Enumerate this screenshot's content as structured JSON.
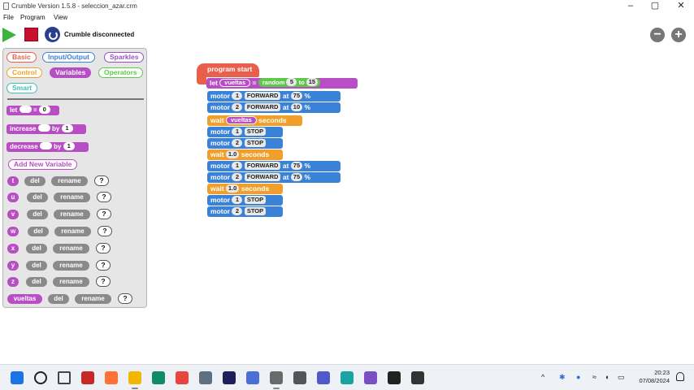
{
  "window": {
    "title": "Crumble Version 1.5.8 - seleccion_azar.crm",
    "controls": {
      "minimize": "–",
      "maximize": "▢",
      "close": "✕"
    }
  },
  "menu": [
    "File",
    "Program",
    "View"
  ],
  "toolbar": {
    "status": "Crumble disconnected",
    "zoom_out": "−",
    "zoom_in": "+",
    "colors": {
      "play": "#3cb43c",
      "stop": "#c8102e",
      "refresh": "#2a3f8f"
    }
  },
  "palette": {
    "categories": {
      "basic": "Basic",
      "io": "Input/Output",
      "sparkles": "Sparkles",
      "control": "Control",
      "variables": "Variables",
      "operators": "Operators",
      "smart": "Smart"
    },
    "let_block": {
      "keyword": "let",
      "eq": "=",
      "value": "0"
    },
    "increase_block": {
      "keyword": "increase",
      "by": "by",
      "value": "1"
    },
    "decrease_block": {
      "keyword": "decrease",
      "by": "by",
      "value": "1"
    },
    "add_variable": "Add New Variable",
    "del_label": "del",
    "rename_label": "rename",
    "help_label": "?",
    "variables": [
      "t",
      "u",
      "v",
      "w",
      "x",
      "y",
      "z",
      "vueltas"
    ]
  },
  "program": {
    "start": "program start",
    "let": {
      "keyword": "let",
      "variable": "vueltas",
      "eq": "=",
      "random": "random",
      "from": "5",
      "to_word": "to",
      "to": "15"
    },
    "steps": [
      {
        "kind": "motor-fwd",
        "motor": "motor",
        "num": "1",
        "dir": "FORWARD",
        "at": "at",
        "speed": "75",
        "pct": "%"
      },
      {
        "kind": "motor-fwd",
        "motor": "motor",
        "num": "2",
        "dir": "FORWARD",
        "at": "at",
        "speed": "10",
        "pct": "%"
      },
      {
        "kind": "wait-var",
        "wait": "wait",
        "var": "vueltas",
        "unit": "seconds"
      },
      {
        "kind": "motor-stop",
        "motor": "motor",
        "num": "1",
        "dir": "STOP"
      },
      {
        "kind": "motor-stop",
        "motor": "motor",
        "num": "2",
        "dir": "STOP"
      },
      {
        "kind": "wait-num",
        "wait": "wait",
        "value": "1.0",
        "unit": "seconds"
      },
      {
        "kind": "motor-fwd",
        "motor": "motor",
        "num": "1",
        "dir": "FORWARD",
        "at": "at",
        "speed": "75",
        "pct": "%"
      },
      {
        "kind": "motor-fwd",
        "motor": "motor",
        "num": "2",
        "dir": "FORWARD",
        "at": "at",
        "speed": "75",
        "pct": "%"
      },
      {
        "kind": "wait-num",
        "wait": "wait",
        "value": "1.0",
        "unit": "seconds"
      },
      {
        "kind": "motor-stop",
        "motor": "motor",
        "num": "1",
        "dir": "STOP"
      },
      {
        "kind": "motor-stop",
        "motor": "motor",
        "num": "2",
        "dir": "STOP"
      }
    ]
  },
  "taskbar": {
    "apps": [
      "windows-start-icon",
      "search-icon",
      "task-view-icon",
      "pinned-app-icon",
      "firefox-icon",
      "file-explorer-icon",
      "edge-icon",
      "chrome-icon",
      "settings-icon",
      "audition-icon",
      "vscode-icon",
      "crumble-icon",
      "inkscape-icon",
      "teams-icon",
      "app-icon",
      "app-icon-2",
      "app-icon-3",
      "app-icon-4"
    ],
    "tray": {
      "chevron": "^"
    },
    "clock": {
      "time": "20:23",
      "date": "07/08/2024"
    }
  }
}
